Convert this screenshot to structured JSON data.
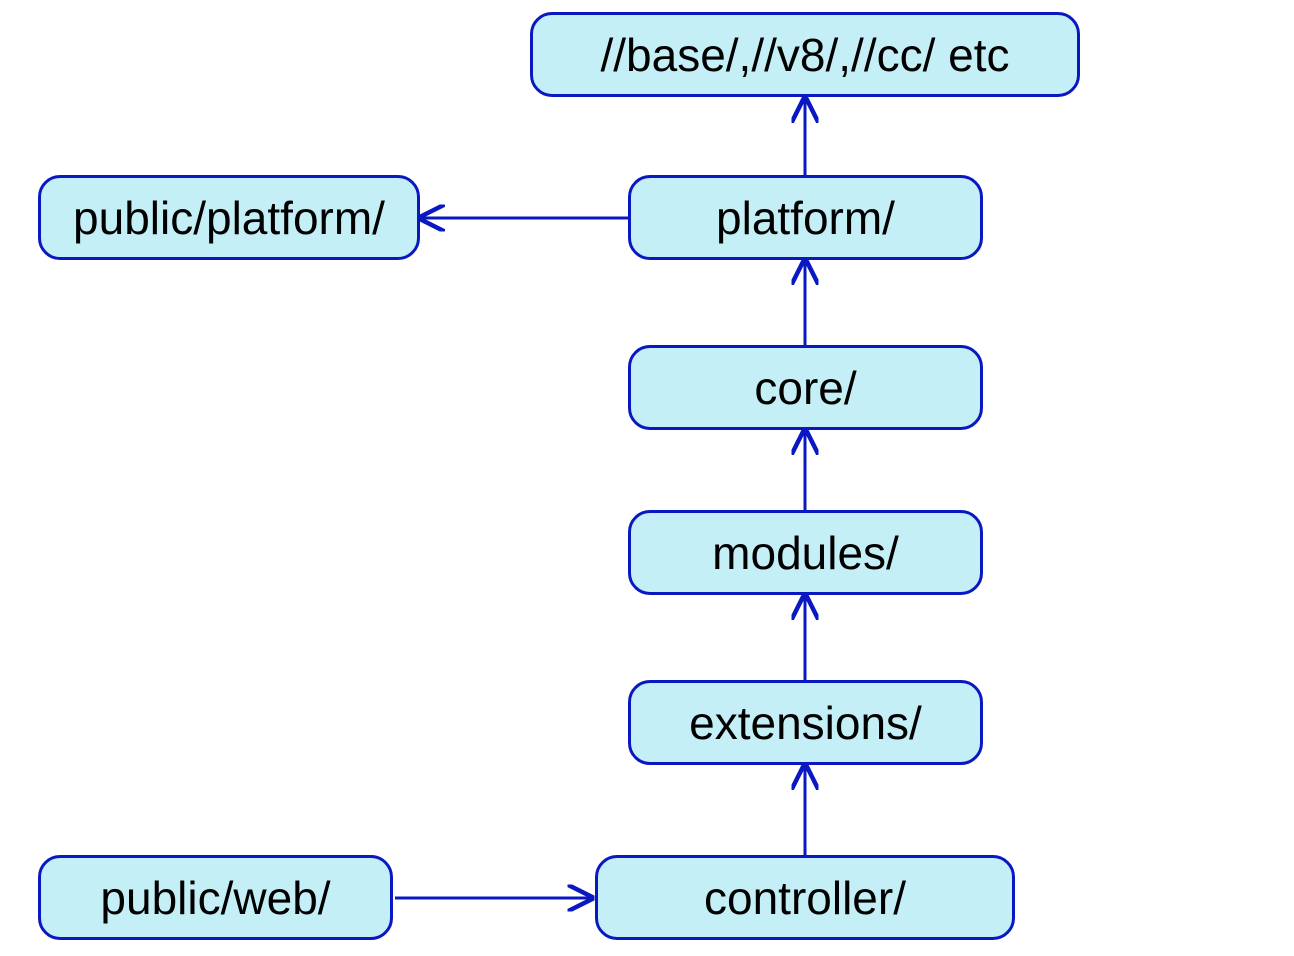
{
  "colors": {
    "node_fill": "#c5eff7",
    "node_border": "#0a18c2",
    "arrow": "#0a18c2"
  },
  "nodes": {
    "base": {
      "label": "//base/,//v8/,//cc/ etc"
    },
    "platform": {
      "label": "platform/"
    },
    "pub_platform": {
      "label": "public/platform/"
    },
    "core": {
      "label": "core/"
    },
    "modules": {
      "label": "modules/"
    },
    "extensions": {
      "label": "extensions/"
    },
    "controller": {
      "label": "controller/"
    },
    "pub_web": {
      "label": "public/web/"
    }
  },
  "edges": [
    {
      "from": "platform",
      "to": "base",
      "dir": "up"
    },
    {
      "from": "core",
      "to": "platform",
      "dir": "up"
    },
    {
      "from": "modules",
      "to": "core",
      "dir": "up"
    },
    {
      "from": "extensions",
      "to": "modules",
      "dir": "up"
    },
    {
      "from": "controller",
      "to": "extensions",
      "dir": "up"
    },
    {
      "from": "platform",
      "to": "pub_platform",
      "dir": "left"
    },
    {
      "from": "pub_web",
      "to": "controller",
      "dir": "right"
    }
  ]
}
